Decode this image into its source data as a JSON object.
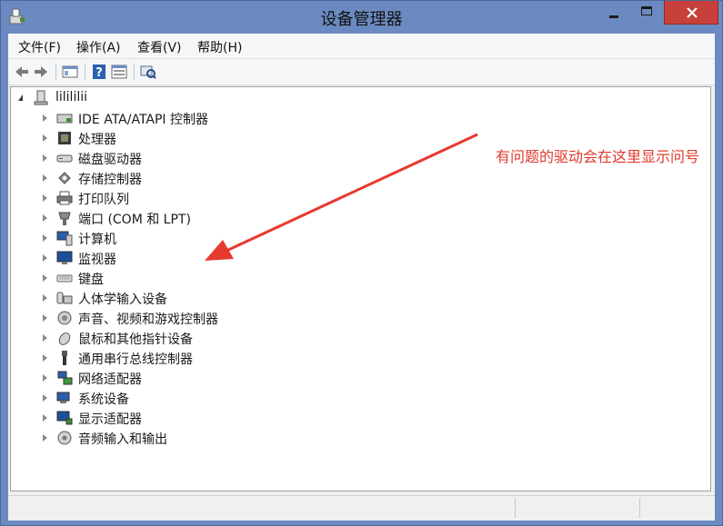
{
  "window": {
    "title": "设备管理器"
  },
  "menu": [
    {
      "label": "文件(F)"
    },
    {
      "label": "操作(A)"
    },
    {
      "label": "查看(V)"
    },
    {
      "label": "帮助(H)"
    }
  ],
  "toolbar": {
    "icons": [
      "back-icon",
      "forward-icon",
      "properties-view-icon",
      "help-icon",
      "list-view-icon",
      "scan-hardware-icon"
    ]
  },
  "tree": {
    "root": {
      "label": "lilililii",
      "icon": "computer-icon"
    },
    "items": [
      {
        "label": "IDE ATA/ATAPI 控制器",
        "icon": "ide-controller-icon"
      },
      {
        "label": "处理器",
        "icon": "processor-icon"
      },
      {
        "label": "磁盘驱动器",
        "icon": "disk-drive-icon"
      },
      {
        "label": "存储控制器",
        "icon": "storage-controller-icon"
      },
      {
        "label": "打印队列",
        "icon": "printer-icon"
      },
      {
        "label": "端口 (COM 和 LPT)",
        "icon": "port-icon"
      },
      {
        "label": "计算机",
        "icon": "computer-icon"
      },
      {
        "label": "监视器",
        "icon": "monitor-icon"
      },
      {
        "label": "键盘",
        "icon": "keyboard-icon"
      },
      {
        "label": "人体学输入设备",
        "icon": "hid-icon"
      },
      {
        "label": "声音、视频和游戏控制器",
        "icon": "sound-icon"
      },
      {
        "label": "鼠标和其他指针设备",
        "icon": "mouse-icon"
      },
      {
        "label": "通用串行总线控制器",
        "icon": "usb-icon"
      },
      {
        "label": "网络适配器",
        "icon": "network-adapter-icon"
      },
      {
        "label": "系统设备",
        "icon": "system-device-icon"
      },
      {
        "label": "显示适配器",
        "icon": "display-adapter-icon"
      },
      {
        "label": "音频输入和输出",
        "icon": "audio-io-icon"
      }
    ]
  },
  "annotation": {
    "text": "有问题的驱动会在这里显示问号"
  },
  "colors": {
    "annotation": "#e0392d",
    "close_button": "#c7413a",
    "title_bar": "#6b8ac1"
  }
}
